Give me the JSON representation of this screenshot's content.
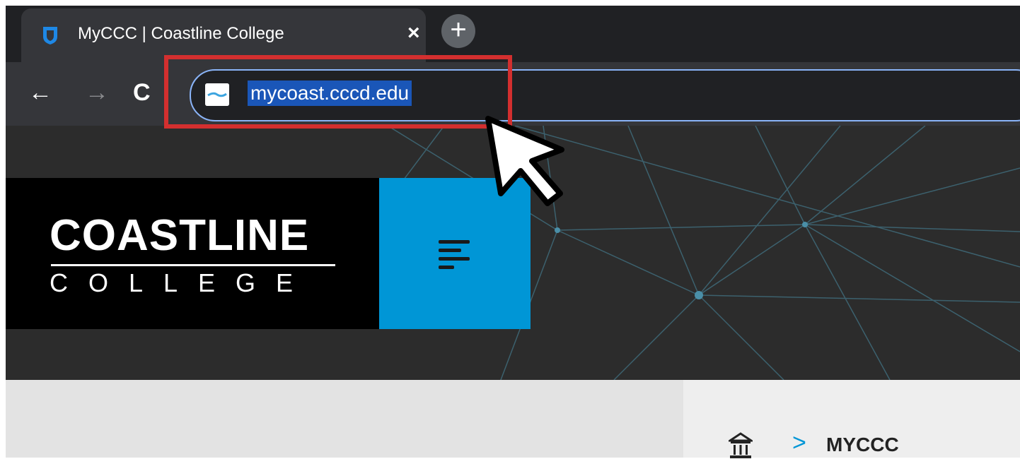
{
  "browser": {
    "tab": {
      "title": "MyCCC | Coastline College",
      "close_glyph": "×",
      "favicon": "shield-icon"
    },
    "new_tab_glyph": "+",
    "nav": {
      "back_glyph": "←",
      "forward_glyph": "→",
      "reload_glyph": "C"
    },
    "address_bar": {
      "url": "mycoast.cccd.edu",
      "site_icon": "site-favicon-icon"
    }
  },
  "header": {
    "logo_main": "COASTLINE",
    "logo_sub": "COLLEGE",
    "menu_icon": "hamburger-icon"
  },
  "breadcrumb": {
    "home_icon": "home-building-icon",
    "separator": ">",
    "current": "MYCCC"
  },
  "colors": {
    "accent": "#0096d6",
    "highlight_box": "#d32f2f",
    "url_selection": "#1a56b8"
  }
}
